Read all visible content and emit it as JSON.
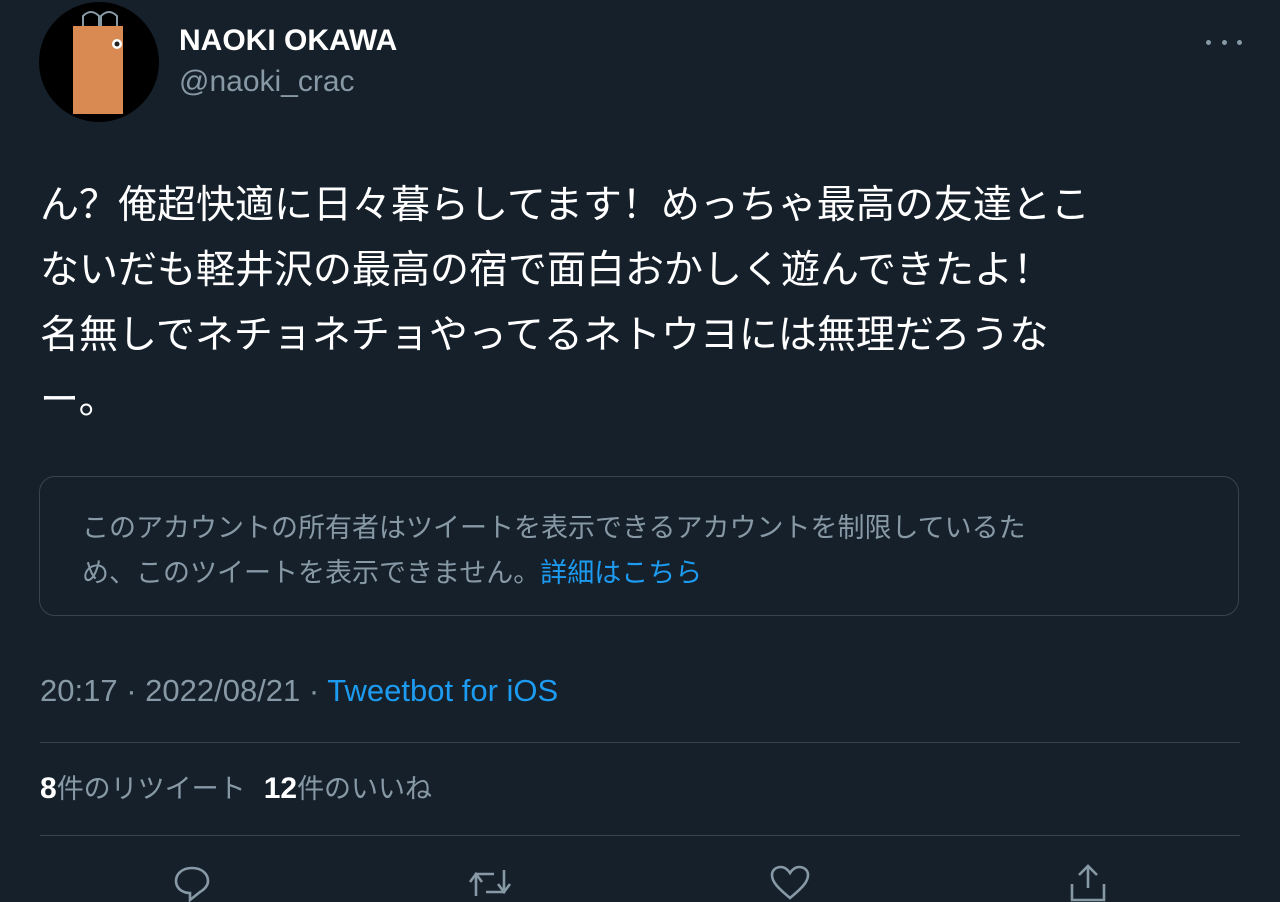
{
  "author": {
    "display_name": "NAOKI OKAWA",
    "handle": "@naoki_crac",
    "avatar_icon": "shopping-bag-avatar"
  },
  "tweet": {
    "lines": [
      "ん？俺超快適に日々暮らしてます！めっちゃ最高の友達とこ",
      "ないだも軽井沢の最高の宿で面白おかしく遊んできたよ！",
      "名無しでネチョネチョやってるネトウヨには無理だろうな",
      "ー。"
    ]
  },
  "notice": {
    "text_line1": "このアカウントの所有者はツイートを表示できるアカウントを制限しているた",
    "text_line2": "め、このツイートを表示できません。",
    "link": "詳細はこちら"
  },
  "meta": {
    "time": "20:17",
    "separator": " · ",
    "date": "2022/08/21",
    "source": "Tweetbot for iOS"
  },
  "stats": {
    "retweets_count": "8",
    "retweets_label": "件のリツイート",
    "likes_count": "12",
    "likes_label": "件のいいね"
  },
  "actions": {
    "icons": [
      "reply-icon",
      "retweet-icon",
      "like-icon",
      "share-icon"
    ]
  },
  "colors": {
    "background": "#15202b",
    "primary_text": "#ffffff",
    "secondary_text": "#8899a6",
    "link": "#1d9bf0",
    "border": "#38444d"
  }
}
